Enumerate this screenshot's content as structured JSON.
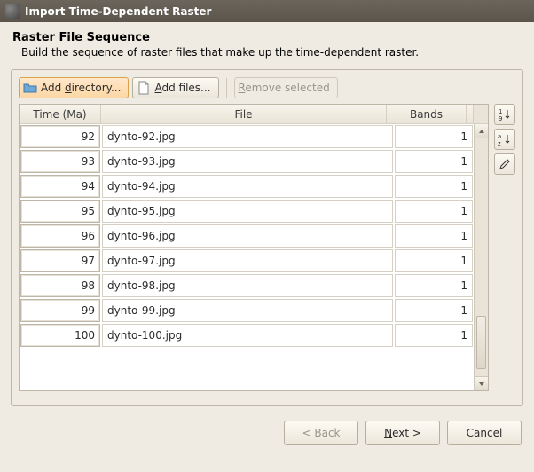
{
  "window": {
    "title": "Import Time-Dependent Raster"
  },
  "heading": {
    "title": "Raster File Sequence",
    "subtitle": "Build the sequence of raster files that make up the time-dependent raster."
  },
  "toolbar": {
    "add_directory": "Add directory...",
    "add_directory_accel": "d",
    "add_files": "Add files...",
    "add_files_accel": "A",
    "remove_selected": "Remove selected",
    "remove_selected_accel": "R"
  },
  "table": {
    "columns": {
      "time": "Time (Ma)",
      "file": "File",
      "bands": "Bands"
    },
    "rows": [
      {
        "time": "92",
        "file": "dynto-92.jpg",
        "bands": "1"
      },
      {
        "time": "93",
        "file": "dynto-93.jpg",
        "bands": "1"
      },
      {
        "time": "94",
        "file": "dynto-94.jpg",
        "bands": "1"
      },
      {
        "time": "95",
        "file": "dynto-95.jpg",
        "bands": "1"
      },
      {
        "time": "96",
        "file": "dynto-96.jpg",
        "bands": "1"
      },
      {
        "time": "97",
        "file": "dynto-97.jpg",
        "bands": "1"
      },
      {
        "time": "98",
        "file": "dynto-98.jpg",
        "bands": "1"
      },
      {
        "time": "99",
        "file": "dynto-99.jpg",
        "bands": "1"
      },
      {
        "time": "100",
        "file": "dynto-100.jpg",
        "bands": "1"
      }
    ]
  },
  "side": {
    "sort_num": "1.9",
    "sort_alpha": "a.z",
    "edit": "/"
  },
  "footer": {
    "back": "< Back",
    "next": "Next >",
    "next_accel": "N",
    "cancel": "Cancel"
  }
}
